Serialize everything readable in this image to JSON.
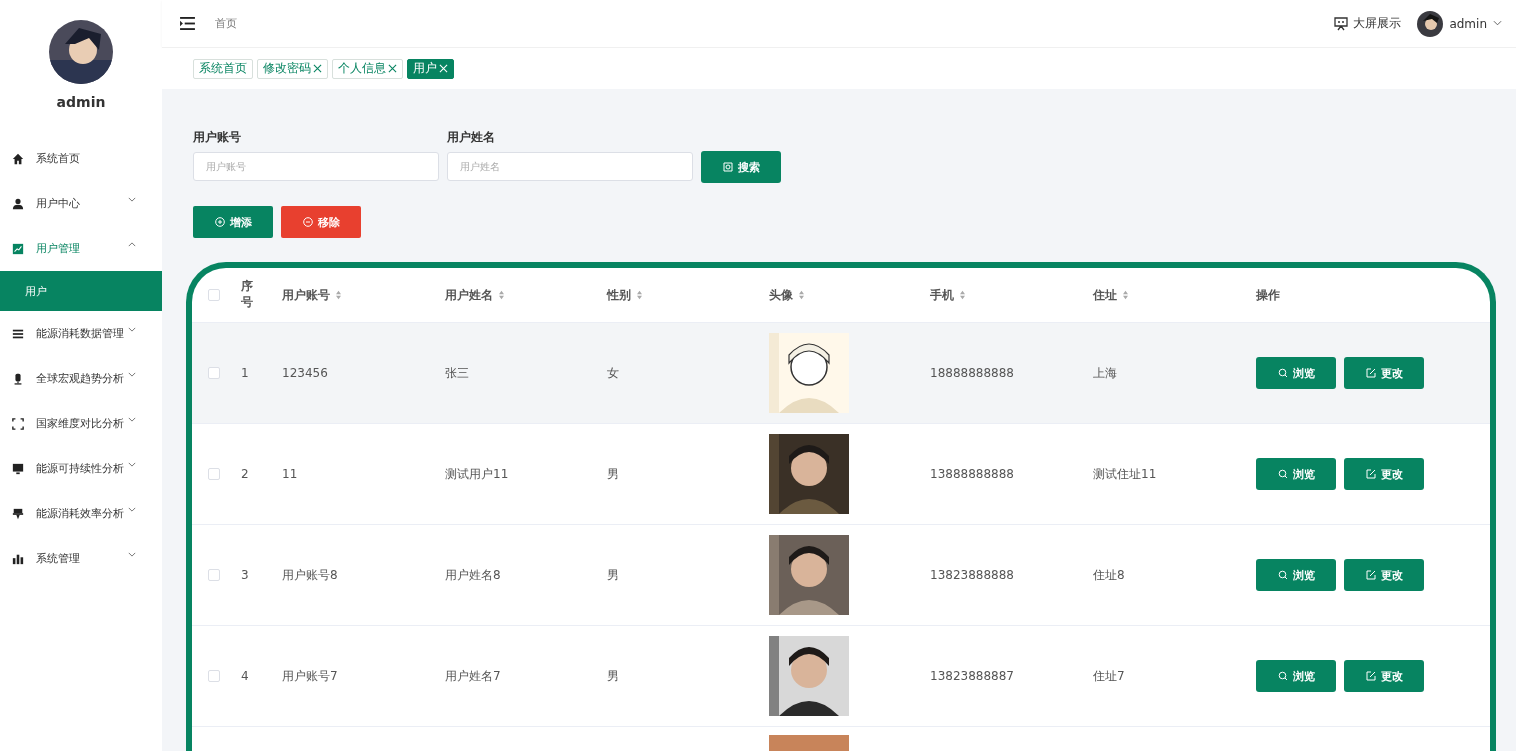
{
  "sidebar": {
    "user": {
      "name": "admin"
    },
    "items": [
      {
        "label": "系统首页",
        "selected": false
      },
      {
        "label": "用户中心",
        "expanded": false,
        "selected": false
      },
      {
        "label": "用户管理",
        "expanded": true,
        "selected": false,
        "children": [
          {
            "label": "用户",
            "selected": true
          }
        ]
      },
      {
        "label": "能源消耗数据管理",
        "expanded": false,
        "selected": false
      },
      {
        "label": "全球宏观趋势分析",
        "expanded": false,
        "selected": false
      },
      {
        "label": "国家维度对比分析",
        "expanded": false,
        "selected": false
      },
      {
        "label": "能源可持续性分析",
        "expanded": false,
        "selected": false
      },
      {
        "label": "能源消耗效率分析",
        "expanded": false,
        "selected": false
      },
      {
        "label": "系统管理",
        "expanded": false,
        "selected": false
      }
    ]
  },
  "header": {
    "breadcrumb": "首页",
    "screen_link": "大屏展示",
    "user": "admin"
  },
  "tabs": [
    {
      "label": "系统首页",
      "closable": false,
      "selected": false
    },
    {
      "label": "修改密码",
      "closable": true,
      "selected": false
    },
    {
      "label": "个人信息",
      "closable": true,
      "selected": false
    },
    {
      "label": "用户",
      "closable": true,
      "selected": true
    }
  ],
  "search": {
    "fields": [
      {
        "label": "用户账号",
        "placeholder": "用户账号"
      },
      {
        "label": "用户姓名",
        "placeholder": "用户姓名"
      }
    ],
    "button": "搜索"
  },
  "actions": [
    {
      "label": "增添",
      "kind": "add"
    },
    {
      "label": "移除",
      "kind": "remove"
    }
  ],
  "table": {
    "columns": [
      {
        "label": "序号",
        "sortable": false
      },
      {
        "label": "用户账号",
        "sortable": true
      },
      {
        "label": "用户姓名",
        "sortable": true
      },
      {
        "label": "性别",
        "sortable": true
      },
      {
        "label": "头像",
        "sortable": true
      },
      {
        "label": "手机",
        "sortable": true
      },
      {
        "label": "住址",
        "sortable": true
      },
      {
        "label": "操作",
        "sortable": false
      }
    ],
    "rows": [
      {
        "index": "1",
        "account": "123456",
        "name": "张三",
        "gender": "女",
        "phone": "18888888888",
        "address": "上海",
        "hovered": true,
        "checked": false,
        "buttons": [
          "浏览",
          "更改"
        ]
      },
      {
        "index": "2",
        "account": "11",
        "name": "测试用户11",
        "gender": "男",
        "phone": "13888888888",
        "address": "测试住址11",
        "hovered": false,
        "checked": false,
        "buttons": [
          "浏览",
          "更改"
        ]
      },
      {
        "index": "3",
        "account": "用户账号8",
        "name": "用户姓名8",
        "gender": "男",
        "phone": "13823888888",
        "address": "住址8",
        "hovered": false,
        "checked": false,
        "buttons": [
          "浏览",
          "更改"
        ]
      },
      {
        "index": "4",
        "account": "用户账号7",
        "name": "用户姓名7",
        "gender": "男",
        "phone": "13823888887",
        "address": "住址7",
        "hovered": false,
        "checked": false,
        "buttons": [
          "浏览",
          "更改"
        ]
      }
    ],
    "all_checked": false
  }
}
